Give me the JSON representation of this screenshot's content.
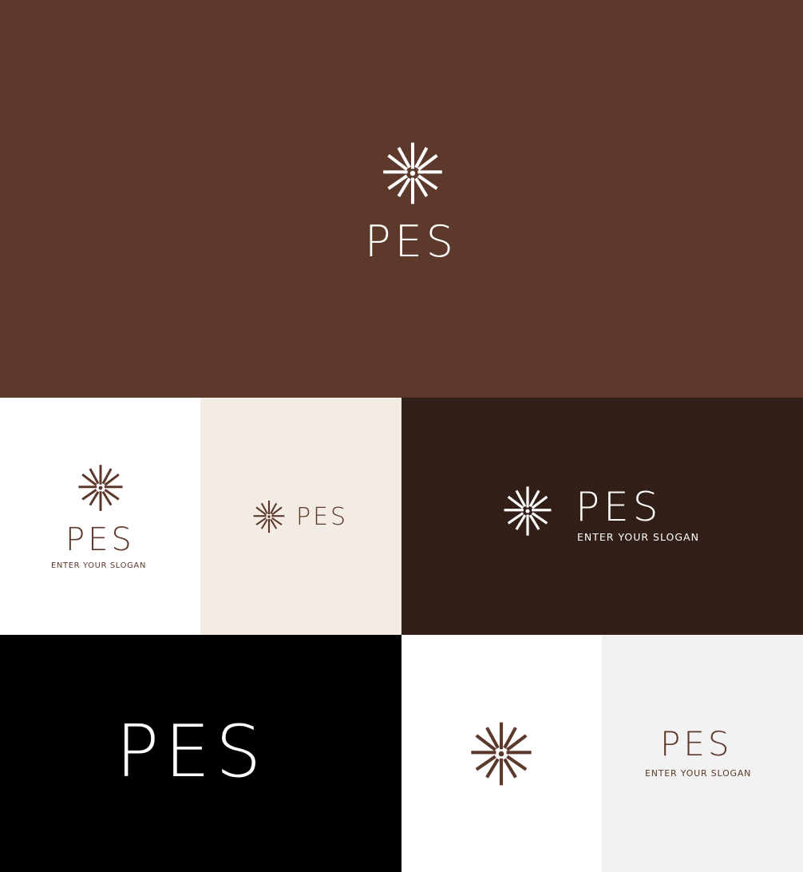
{
  "brand": {
    "name": "PES",
    "slogan": "ENTER YOUR SLOGAN"
  },
  "colors": {
    "brown": "#5c392b",
    "dark_brown": "#321f17",
    "cream": "#f2ece5",
    "white": "#ffffff",
    "black": "#000000",
    "light_gray": "#f2f2f2"
  },
  "icons": {
    "logo_mark": "starburst-icon"
  }
}
